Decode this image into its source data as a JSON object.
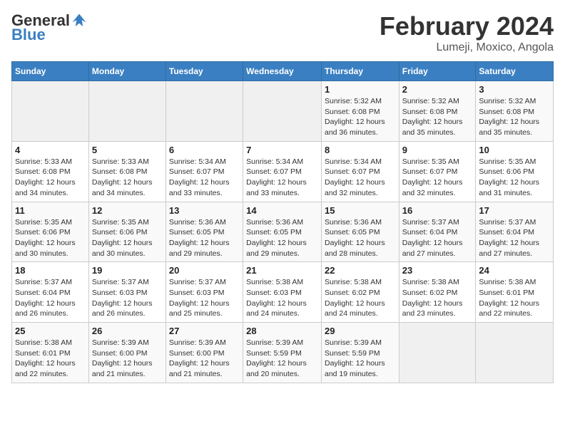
{
  "header": {
    "logo_general": "General",
    "logo_blue": "Blue",
    "title": "February 2024",
    "subtitle": "Lumeji, Moxico, Angola"
  },
  "columns": [
    "Sunday",
    "Monday",
    "Tuesday",
    "Wednesday",
    "Thursday",
    "Friday",
    "Saturday"
  ],
  "weeks": [
    [
      {
        "day": "",
        "info": ""
      },
      {
        "day": "",
        "info": ""
      },
      {
        "day": "",
        "info": ""
      },
      {
        "day": "",
        "info": ""
      },
      {
        "day": "1",
        "info": "Sunrise: 5:32 AM\nSunset: 6:08 PM\nDaylight: 12 hours\nand 36 minutes."
      },
      {
        "day": "2",
        "info": "Sunrise: 5:32 AM\nSunset: 6:08 PM\nDaylight: 12 hours\nand 35 minutes."
      },
      {
        "day": "3",
        "info": "Sunrise: 5:32 AM\nSunset: 6:08 PM\nDaylight: 12 hours\nand 35 minutes."
      }
    ],
    [
      {
        "day": "4",
        "info": "Sunrise: 5:33 AM\nSunset: 6:08 PM\nDaylight: 12 hours\nand 34 minutes."
      },
      {
        "day": "5",
        "info": "Sunrise: 5:33 AM\nSunset: 6:08 PM\nDaylight: 12 hours\nand 34 minutes."
      },
      {
        "day": "6",
        "info": "Sunrise: 5:34 AM\nSunset: 6:07 PM\nDaylight: 12 hours\nand 33 minutes."
      },
      {
        "day": "7",
        "info": "Sunrise: 5:34 AM\nSunset: 6:07 PM\nDaylight: 12 hours\nand 33 minutes."
      },
      {
        "day": "8",
        "info": "Sunrise: 5:34 AM\nSunset: 6:07 PM\nDaylight: 12 hours\nand 32 minutes."
      },
      {
        "day": "9",
        "info": "Sunrise: 5:35 AM\nSunset: 6:07 PM\nDaylight: 12 hours\nand 32 minutes."
      },
      {
        "day": "10",
        "info": "Sunrise: 5:35 AM\nSunset: 6:06 PM\nDaylight: 12 hours\nand 31 minutes."
      }
    ],
    [
      {
        "day": "11",
        "info": "Sunrise: 5:35 AM\nSunset: 6:06 PM\nDaylight: 12 hours\nand 30 minutes."
      },
      {
        "day": "12",
        "info": "Sunrise: 5:35 AM\nSunset: 6:06 PM\nDaylight: 12 hours\nand 30 minutes."
      },
      {
        "day": "13",
        "info": "Sunrise: 5:36 AM\nSunset: 6:05 PM\nDaylight: 12 hours\nand 29 minutes."
      },
      {
        "day": "14",
        "info": "Sunrise: 5:36 AM\nSunset: 6:05 PM\nDaylight: 12 hours\nand 29 minutes."
      },
      {
        "day": "15",
        "info": "Sunrise: 5:36 AM\nSunset: 6:05 PM\nDaylight: 12 hours\nand 28 minutes."
      },
      {
        "day": "16",
        "info": "Sunrise: 5:37 AM\nSunset: 6:04 PM\nDaylight: 12 hours\nand 27 minutes."
      },
      {
        "day": "17",
        "info": "Sunrise: 5:37 AM\nSunset: 6:04 PM\nDaylight: 12 hours\nand 27 minutes."
      }
    ],
    [
      {
        "day": "18",
        "info": "Sunrise: 5:37 AM\nSunset: 6:04 PM\nDaylight: 12 hours\nand 26 minutes."
      },
      {
        "day": "19",
        "info": "Sunrise: 5:37 AM\nSunset: 6:03 PM\nDaylight: 12 hours\nand 26 minutes."
      },
      {
        "day": "20",
        "info": "Sunrise: 5:37 AM\nSunset: 6:03 PM\nDaylight: 12 hours\nand 25 minutes."
      },
      {
        "day": "21",
        "info": "Sunrise: 5:38 AM\nSunset: 6:03 PM\nDaylight: 12 hours\nand 24 minutes."
      },
      {
        "day": "22",
        "info": "Sunrise: 5:38 AM\nSunset: 6:02 PM\nDaylight: 12 hours\nand 24 minutes."
      },
      {
        "day": "23",
        "info": "Sunrise: 5:38 AM\nSunset: 6:02 PM\nDaylight: 12 hours\nand 23 minutes."
      },
      {
        "day": "24",
        "info": "Sunrise: 5:38 AM\nSunset: 6:01 PM\nDaylight: 12 hours\nand 22 minutes."
      }
    ],
    [
      {
        "day": "25",
        "info": "Sunrise: 5:38 AM\nSunset: 6:01 PM\nDaylight: 12 hours\nand 22 minutes."
      },
      {
        "day": "26",
        "info": "Sunrise: 5:39 AM\nSunset: 6:00 PM\nDaylight: 12 hours\nand 21 minutes."
      },
      {
        "day": "27",
        "info": "Sunrise: 5:39 AM\nSunset: 6:00 PM\nDaylight: 12 hours\nand 21 minutes."
      },
      {
        "day": "28",
        "info": "Sunrise: 5:39 AM\nSunset: 5:59 PM\nDaylight: 12 hours\nand 20 minutes."
      },
      {
        "day": "29",
        "info": "Sunrise: 5:39 AM\nSunset: 5:59 PM\nDaylight: 12 hours\nand 19 minutes."
      },
      {
        "day": "",
        "info": ""
      },
      {
        "day": "",
        "info": ""
      }
    ]
  ]
}
